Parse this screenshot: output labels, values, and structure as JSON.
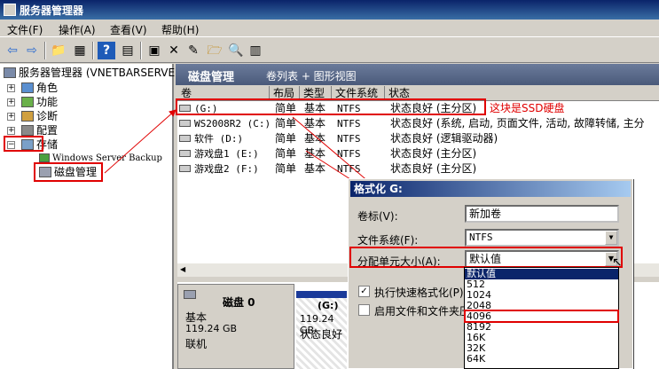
{
  "window": {
    "title": "服务器管理器"
  },
  "menu": [
    "文件(F)",
    "操作(A)",
    "查看(V)",
    "帮助(H)"
  ],
  "toolbar": {
    "icons": [
      "back-arrow-icon",
      "forward-arrow-icon",
      "up-folder-icon",
      "show-tree-icon",
      "help-icon",
      "view-icon",
      "properties-icon",
      "delete-icon",
      "edit-icon",
      "open-folder-icon",
      "search-icon",
      "wizard-icon"
    ]
  },
  "tree": {
    "root": "服务器管理器 (VNETBARSERVER)",
    "items": [
      "角色",
      "功能",
      "诊断",
      "配置",
      "存储"
    ],
    "storage_children": [
      "Windows Server Backup",
      "磁盘管理"
    ]
  },
  "main": {
    "title": "磁盘管理",
    "subtitle": "卷列表 + 图形视图",
    "columns": [
      "卷",
      "布局",
      "类型",
      "文件系统",
      "状态"
    ],
    "rows": [
      {
        "vol": "(G:)",
        "layout": "简单",
        "type": "基本",
        "fs": "NTFS",
        "status": "状态良好 (主分区)"
      },
      {
        "vol": "WS2008R2 (C:)",
        "layout": "简单",
        "type": "基本",
        "fs": "NTFS",
        "status": "状态良好 (系统, 启动, 页面文件, 活动, 故障转储, 主分"
      },
      {
        "vol": "软件 (D:)",
        "layout": "简单",
        "type": "基本",
        "fs": "NTFS",
        "status": "状态良好 (逻辑驱动器)"
      },
      {
        "vol": "游戏盘1 (E:)",
        "layout": "简单",
        "type": "基本",
        "fs": "NTFS",
        "status": "状态良好 (主分区)"
      },
      {
        "vol": "游戏盘2 (F:)",
        "layout": "简单",
        "type": "基本",
        "fs": "NTFS",
        "status": "状态良好 (主分区)"
      }
    ],
    "annotation": "这块是SSD硬盘"
  },
  "disk0": {
    "name": "磁盘 0",
    "type": "基本",
    "size": "119.24 GB",
    "state": "联机",
    "part_label": "(G:)",
    "part_size": "119.24 GB",
    "part_status": "状态良好"
  },
  "format_dialog": {
    "title": "格式化 G:",
    "volume_label": "卷标(V):",
    "volume_value": "新加卷",
    "fs_label": "文件系统(F):",
    "fs_value": "NTFS",
    "alloc_label": "分配单元大小(A):",
    "alloc_value": "默认值",
    "quick_format": "执行快速格式化(P)",
    "compression": "启用文件和文件夹压",
    "options": [
      "默认值",
      "512",
      "1024",
      "2048",
      "4096",
      "8192",
      "16K",
      "32K",
      "64K"
    ],
    "selected_option": "默认值"
  },
  "colors": {
    "annotation_red": "#e00000",
    "selection_blue": "#0a246a"
  }
}
